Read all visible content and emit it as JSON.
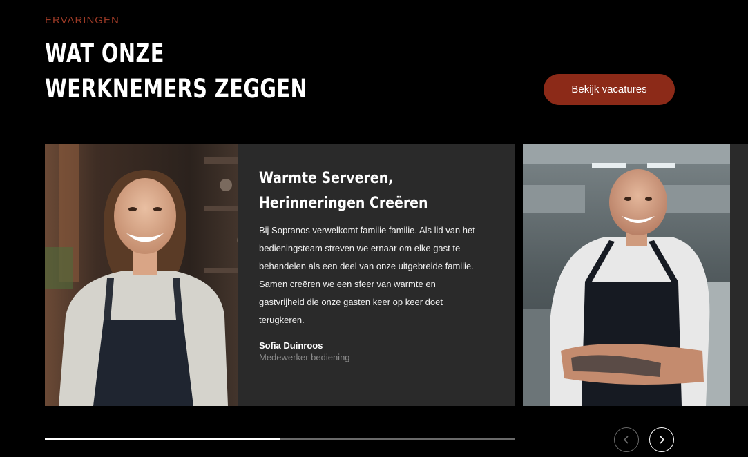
{
  "section": {
    "eyebrow": "ERVARINGEN",
    "heading_line1": "WAT ONZE",
    "heading_line2": "WERKNEMERS ZEGGEN",
    "cta_label": "Bekijk vacatures"
  },
  "testimonial": {
    "title": "Warmte Serveren, Herinneringen Creëren",
    "text": "Bij Sopranos verwelkomt familie familie. Als lid van het bedieningsteam streven we ernaar om elke gast te behandelen als een deel van onze uitgebreide familie. Samen creëren we een sfeer van warmte en gastvrijheid die onze gasten keer op keer doet terugkeren.",
    "name": "Sofia Duinroos",
    "role": "Medewerker bediening"
  },
  "slider": {
    "progress": 0.5,
    "prev_icon": "chevron-left-icon",
    "next_icon": "chevron-right-icon"
  },
  "colors": {
    "accent": "#8c2a18",
    "eyebrow": "#9c3a26",
    "card_bg": "#2a2a2a",
    "page_bg": "#000000"
  }
}
